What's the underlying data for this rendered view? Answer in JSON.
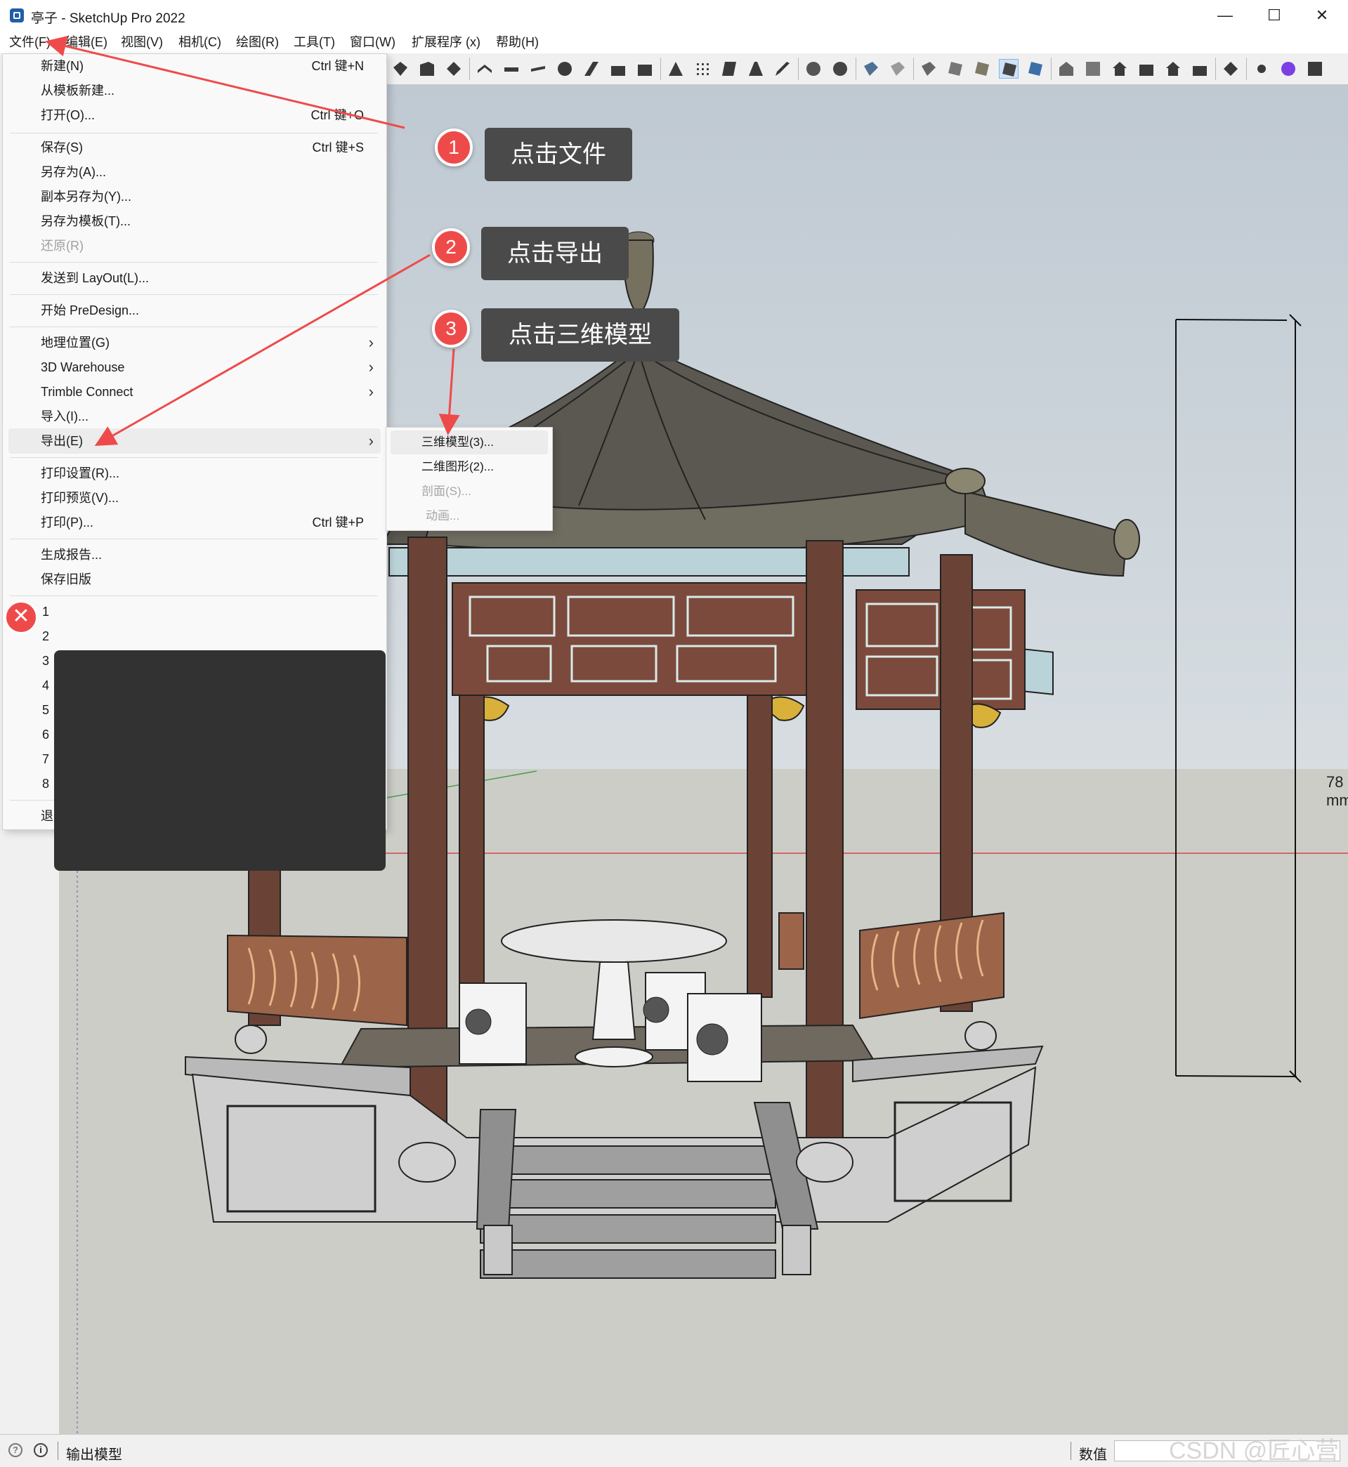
{
  "window": {
    "title": "亭子 - SketchUp Pro 2022",
    "controls": {
      "minimize": "—",
      "maximize": "☐",
      "close": "✕"
    }
  },
  "menubar": {
    "items": [
      {
        "label": "文件(F)"
      },
      {
        "label": "编辑(E)"
      },
      {
        "label": "视图(V)"
      },
      {
        "label": "相机(C)"
      },
      {
        "label": "绘图(R)"
      },
      {
        "label": "工具(T)"
      },
      {
        "label": "窗口(W)"
      },
      {
        "label": "扩展程序 (x)"
      },
      {
        "label": "帮助(H)"
      }
    ]
  },
  "file_menu": {
    "items": [
      {
        "label": "新建(N)",
        "shortcut": "Ctrl 键+N"
      },
      {
        "label": "从模板新建..."
      },
      {
        "label": "打开(O)...",
        "shortcut": "Ctrl 键+O"
      },
      {
        "label": "保存(S)",
        "shortcut": "Ctrl 键+S"
      },
      {
        "label": "另存为(A)..."
      },
      {
        "label": "副本另存为(Y)..."
      },
      {
        "label": "另存为模板(T)..."
      },
      {
        "label": "还原(R)",
        "disabled": true
      },
      {
        "label": "发送到 LayOut(L)..."
      },
      {
        "label": "开始 PreDesign..."
      },
      {
        "label": "地理位置(G)",
        "submenu": true
      },
      {
        "label": "3D Warehouse",
        "submenu": true
      },
      {
        "label": "Trimble Connect",
        "submenu": true
      },
      {
        "label": "导入(I)..."
      },
      {
        "label": "导出(E)",
        "submenu": true,
        "highlighted": true
      },
      {
        "label": "打印设置(R)..."
      },
      {
        "label": "打印预览(V)..."
      },
      {
        "label": "打印(P)...",
        "shortcut": "Ctrl 键+P"
      },
      {
        "label": "生成报告..."
      },
      {
        "label": "保存旧版"
      },
      {
        "label": "退出(X)"
      }
    ],
    "submenu_arrow": "›",
    "recent_files": [
      "1",
      "2",
      "3",
      "4",
      "5",
      "6",
      "7",
      "8"
    ]
  },
  "export_submenu": {
    "items": [
      {
        "label": "三维模型(3)...",
        "highlighted": true
      },
      {
        "label": "二维图形(2)..."
      },
      {
        "label": "剖面(S)...",
        "disabled": true
      },
      {
        "label": "动画...",
        "disabled": true
      }
    ]
  },
  "annotations": [
    {
      "number": "1",
      "text": "点击文件"
    },
    {
      "number": "2",
      "text": "点击导出"
    },
    {
      "number": "3",
      "text": "点击三维模型"
    }
  ],
  "redaction_icon": "✕",
  "viewport": {
    "dimension_label": "78 mm",
    "model": "pavilion"
  },
  "statusbar": {
    "message": "输出模型",
    "measurements_label": "数值",
    "info_icon": "i",
    "geo_icon": "?"
  },
  "watermark": "CSDN @匠心营",
  "colors": {
    "annotation_red": "#ef4a4a",
    "callout_bg": "#4a4a4a",
    "menu_bg": "#f9f9f9",
    "highlight": "#ececec"
  },
  "icons": [
    "app-logo-icon",
    "minimize-icon",
    "maximize-icon",
    "close-icon",
    "chevron-right-icon",
    "info-icon",
    "geo-location-icon"
  ]
}
